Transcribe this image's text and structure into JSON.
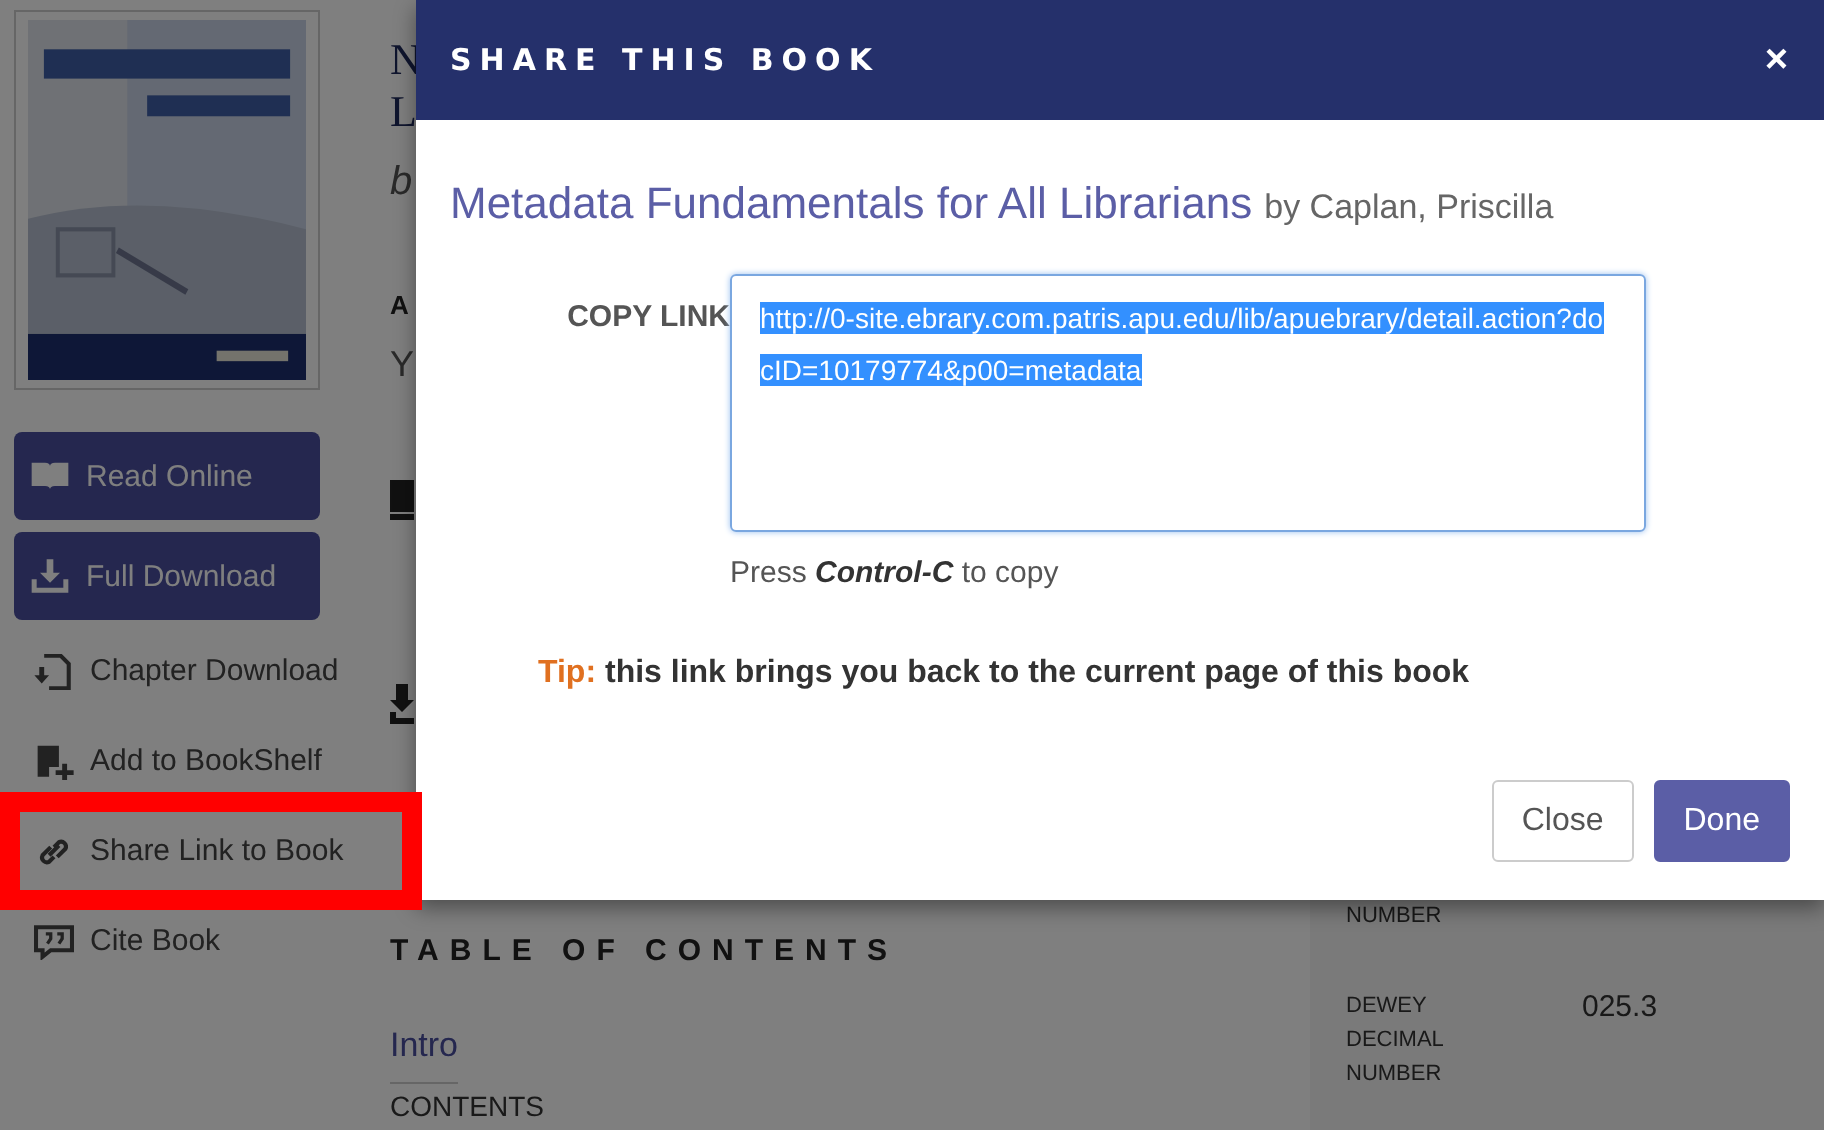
{
  "sidebar": {
    "actions": [
      {
        "label": "Read Online",
        "kind": "primary",
        "highlighted": false
      },
      {
        "label": "Full Download",
        "kind": "primary",
        "highlighted": false
      },
      {
        "label": "Chapter Download",
        "kind": "link",
        "highlighted": false
      },
      {
        "label": "Add to BookShelf",
        "kind": "link",
        "highlighted": false
      },
      {
        "label": "Share Link to Book",
        "kind": "link",
        "highlighted": true
      },
      {
        "label": "Cite Book",
        "kind": "link",
        "highlighted": false
      }
    ]
  },
  "main": {
    "title_lines": [
      "N",
      "L"
    ],
    "byline": "b",
    "label_fragment": "A",
    "value_fragment": "Y",
    "toc": {
      "heading": "TABLE OF CONTENTS",
      "entries": [
        "Intro",
        "CONTENTS"
      ]
    }
  },
  "details": [
    {
      "label": "NUMBER"
    },
    {
      "label": "DEWEY DECIMAL NUMBER",
      "value": "025.3"
    }
  ],
  "modal": {
    "title": "SHARE THIS BOOK",
    "close": "×",
    "book_title": "Metadata Fundamentals for All Librarians",
    "author": "by Caplan, Priscilla",
    "copy_label": "COPY LINK",
    "link": "http://0-site.ebrary.com.patris.apu.edu/lib/apuebrary/detail.action?docID=10179774&p00=metadata",
    "link_selected": true,
    "hint": "Press **Control-C** to copy",
    "tip_label": "Tip:",
    "tip": "this link brings you back to the current page of this book",
    "buttons": [
      {
        "label": "Close",
        "kind": "secondary"
      },
      {
        "label": "Done",
        "kind": "primary"
      }
    ]
  }
}
